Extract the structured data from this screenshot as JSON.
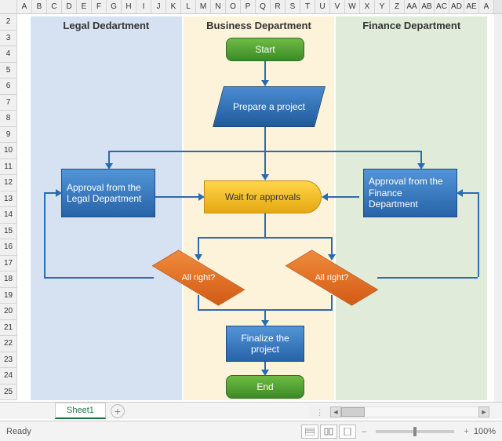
{
  "columns": [
    "A",
    "B",
    "C",
    "D",
    "E",
    "F",
    "G",
    "H",
    "I",
    "J",
    "K",
    "L",
    "M",
    "N",
    "O",
    "P",
    "Q",
    "R",
    "S",
    "T",
    "U",
    "V",
    "W",
    "X",
    "Y",
    "Z",
    "AA",
    "AB",
    "AC",
    "AD",
    "AE",
    "A"
  ],
  "rows": [
    "2",
    "3",
    "4",
    "5",
    "6",
    "7",
    "8",
    "9",
    "10",
    "11",
    "12",
    "13",
    "14",
    "15",
    "16",
    "17",
    "18",
    "19",
    "20",
    "21",
    "22",
    "23",
    "24",
    "25"
  ],
  "lanes": {
    "legal": "Legal Dedartment",
    "business": "Business Department",
    "finance": "Finance Department"
  },
  "shapes": {
    "start": "Start",
    "prepare": "Prepare a project",
    "approval_legal": "Approval from the Legal Department",
    "wait": "Wait for approvals",
    "approval_finance": "Approval from the Finance Department",
    "allright_left": "All right?",
    "allright_right": "All right?",
    "finalize": "Finalize the project",
    "end": "End"
  },
  "tab": "Sheet1",
  "status": "Ready",
  "zoom": "100%"
}
